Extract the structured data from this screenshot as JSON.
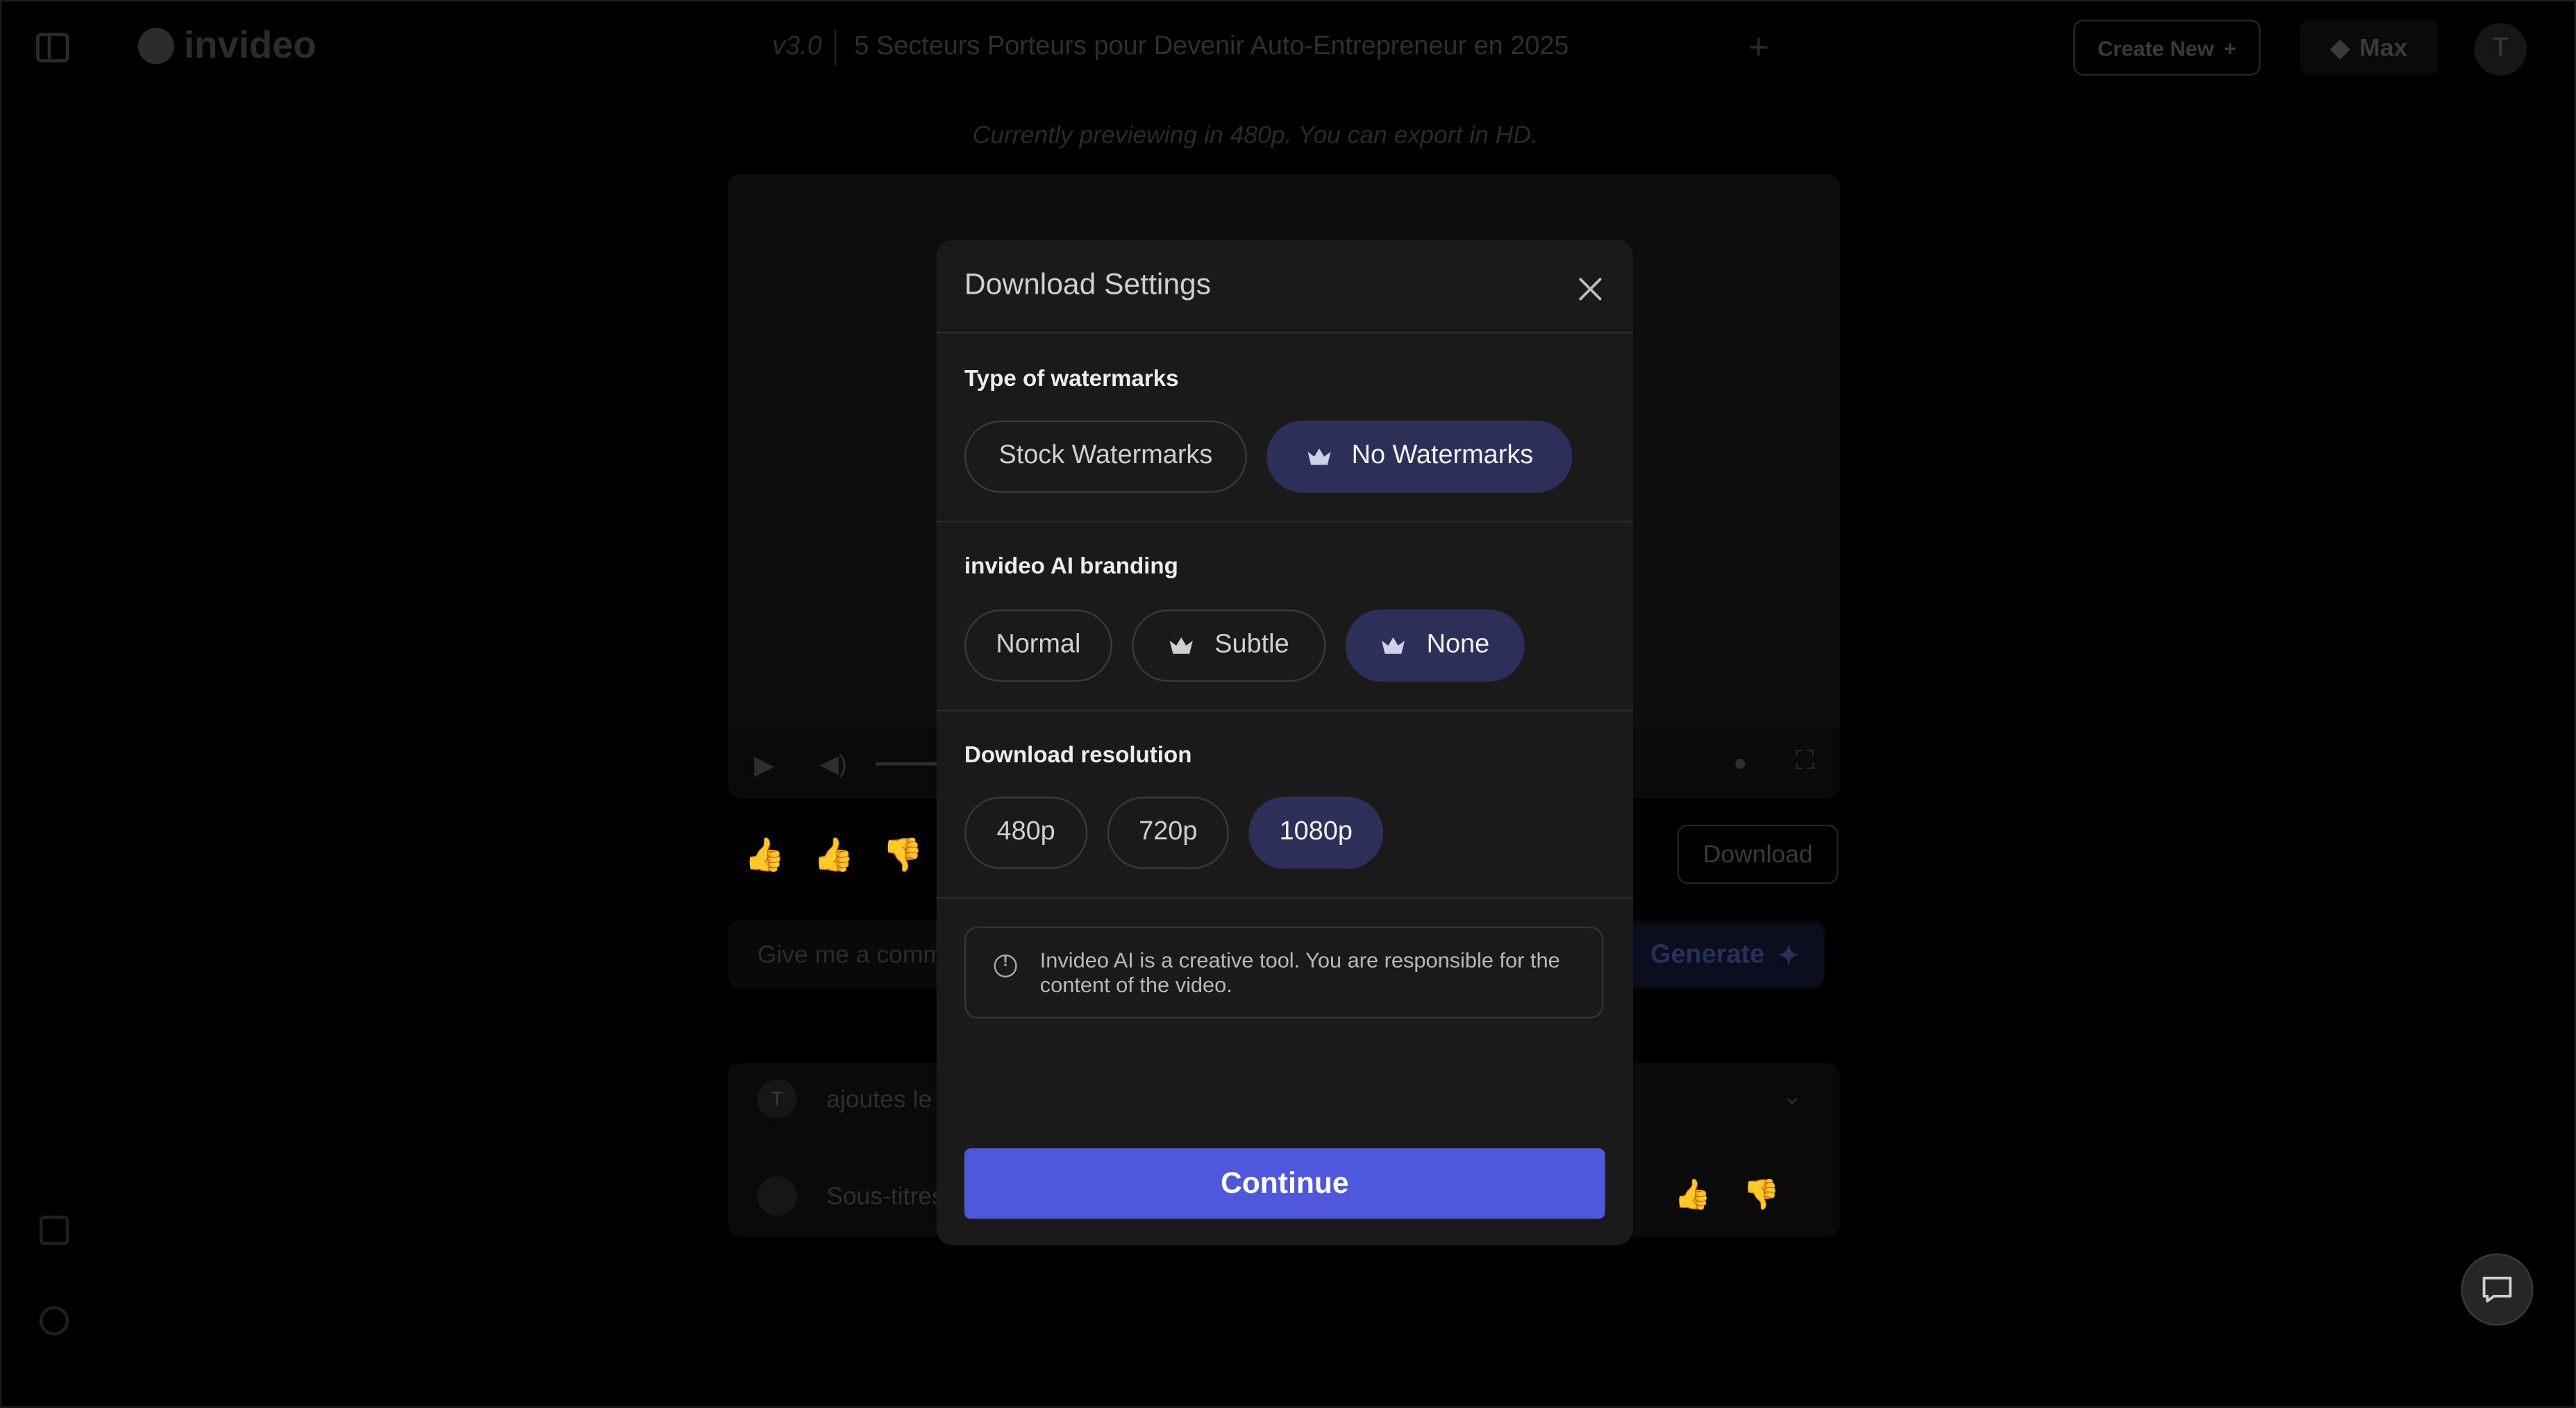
{
  "header": {
    "brand": "invideo",
    "version": "v3.0",
    "project_title": "5 Secteurs Porteurs pour Devenir Auto-Entrepreneur en 2025",
    "create_new_label": "Create New",
    "plan_label": "Max",
    "avatar_initial": "T"
  },
  "preview_note": "Currently previewing in 480p. You can export in HD.",
  "background": {
    "download_label": "Download",
    "prompt_placeholder": "Give me a comm",
    "generate_label": "Generate",
    "chat_items": [
      {
        "avatar": "T",
        "text": "ajoutes le"
      },
      {
        "avatar": "",
        "text": "Sous-titres"
      }
    ]
  },
  "modal": {
    "title": "Download Settings",
    "watermarks": {
      "label": "Type of watermarks",
      "options": [
        "Stock Watermarks",
        "No Watermarks"
      ],
      "selected": "No Watermarks"
    },
    "branding": {
      "label": "invideo AI branding",
      "options": [
        "Normal",
        "Subtle",
        "None"
      ],
      "selected": "None"
    },
    "resolution": {
      "label": "Download resolution",
      "options": [
        "480p",
        "720p",
        "1080p"
      ],
      "selected": "1080p"
    },
    "notice": "Invideo AI is a creative tool. You are responsible for the content of the video.",
    "continue_label": "Continue"
  },
  "colors": {
    "accent": "#4f57da",
    "selected_pill": "#2c2f57",
    "modal_bg": "#1a1a1a"
  }
}
